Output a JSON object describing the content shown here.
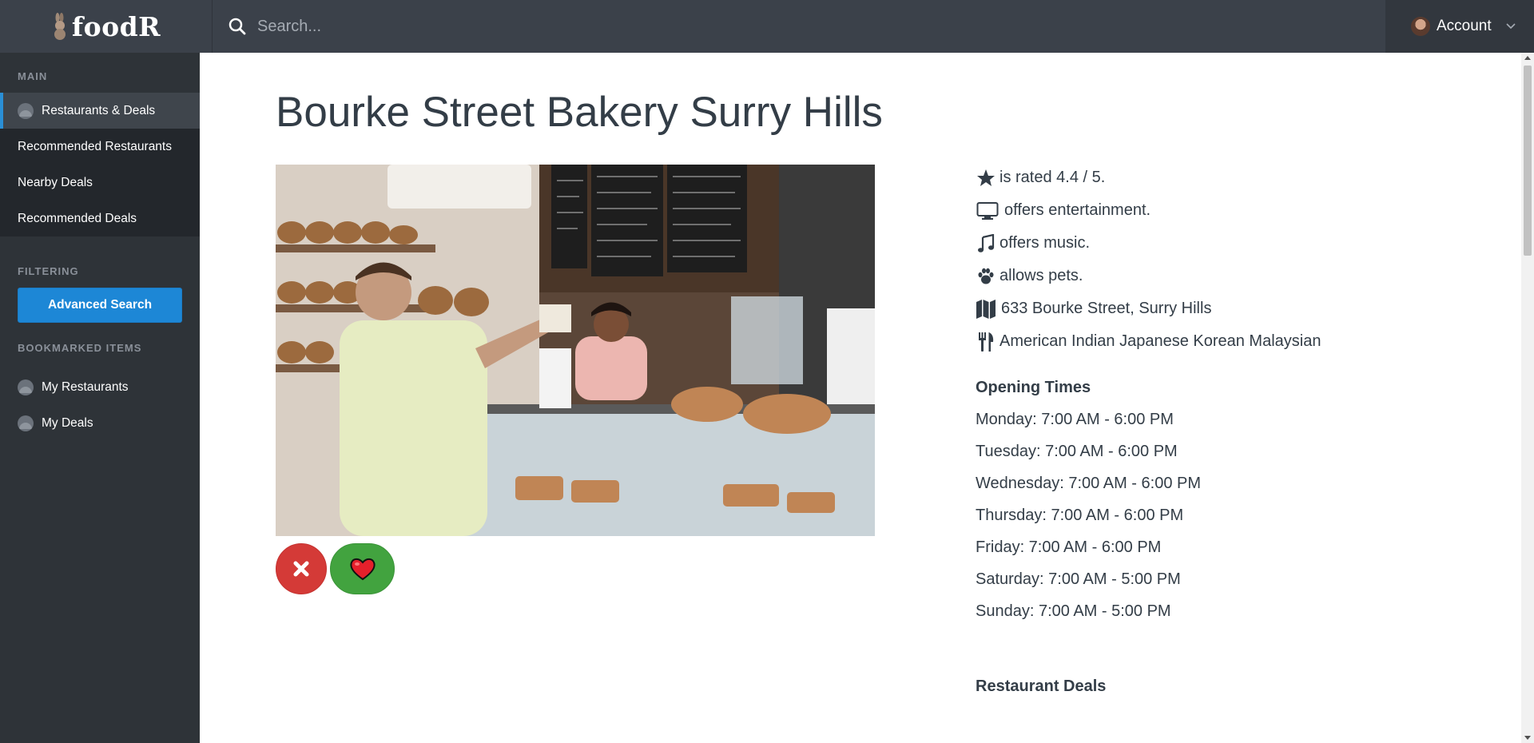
{
  "app": {
    "brand": "foodR",
    "search_placeholder": "Search...",
    "account_label": "Account"
  },
  "sidebar": {
    "main_label": "MAIN",
    "main_items": [
      {
        "label": "Restaurants & Deals",
        "icon": "circle-icon",
        "active": true
      },
      {
        "label": "Recommended Restaurants"
      },
      {
        "label": "Nearby Deals"
      },
      {
        "label": "Recommended Deals"
      }
    ],
    "filtering_label": "FILTERING",
    "advanced_search_label": "Advanced Search",
    "bookmarked_label": "BOOKMARKED ITEMS",
    "bookmarked_items": [
      {
        "label": "My Restaurants",
        "icon": "circle-icon"
      },
      {
        "label": "My Deals",
        "icon": "circle-icon"
      }
    ]
  },
  "restaurant": {
    "name": "Bourke Street Bakery Surry Hills",
    "features": [
      {
        "icon": "star-icon",
        "text": "is rated 4.4 / 5."
      },
      {
        "icon": "monitor-icon",
        "text": "offers entertainment."
      },
      {
        "icon": "music-icon",
        "text": "offers music."
      },
      {
        "icon": "paw-icon",
        "text": "allows pets."
      },
      {
        "icon": "map-icon",
        "text": "633 Bourke Street, Surry Hills"
      },
      {
        "icon": "cutlery-icon",
        "text": "American Indian Japanese Korean Malaysian"
      }
    ],
    "opening_times_label": "Opening Times",
    "opening_times": [
      "Monday: 7:00 AM - 6:00 PM",
      "Tuesday: 7:00 AM - 6:00 PM",
      "Wednesday: 7:00 AM - 6:00 PM",
      "Thursday: 7:00 AM - 6:00 PM",
      "Friday: 7:00 AM - 6:00 PM",
      "Saturday: 7:00 AM - 5:00 PM",
      "Sunday: 7:00 AM - 5:00 PM"
    ],
    "deals_label": "Restaurant Deals"
  },
  "colors": {
    "topbar": "#3b414a",
    "sidebar": "#2e3338",
    "accent": "#1d87d6",
    "reject": "#d43a37",
    "like": "#42a33f"
  }
}
